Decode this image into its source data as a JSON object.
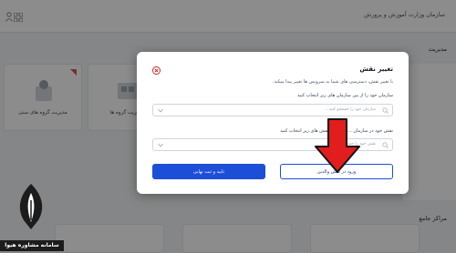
{
  "header": {
    "org_title": "سازمان وزارت آموزش و پرورش"
  },
  "background": {
    "section_title_1": "مدیریت",
    "section_title_2": "مراکز جامع",
    "cards": [
      {
        "label": "مدیریت گروه های سنی"
      },
      {
        "label": "مدیریت گروه ها"
      }
    ]
  },
  "modal": {
    "title": "تغییر نقش",
    "description": "با تغییر نقش، دسترسی های شما به سرویس ها تغییر پیدا میکند.",
    "org_label": "سازمان خود را از بین سازمان های زیر انتخاب کنید",
    "org_placeholder": "سازمان خود را جستجو کنید...",
    "role_label": "نقش خود در سازمان ... را از بین نقش های زیر انتخاب کنید",
    "role_placeholder": "نقش خود را جستجو کنید...",
    "parent_role_button": "ورود در نقش والدین",
    "confirm_button": "تایید و ثبت نهایی"
  },
  "logo": {
    "text": "سامانه مشاوره هیوا"
  },
  "colors": {
    "primary": "#1d4ed8",
    "close_icon": "#c81e1e",
    "arrow": "#e11d1d",
    "overlay": "rgba(0,0,0,0.45)"
  }
}
